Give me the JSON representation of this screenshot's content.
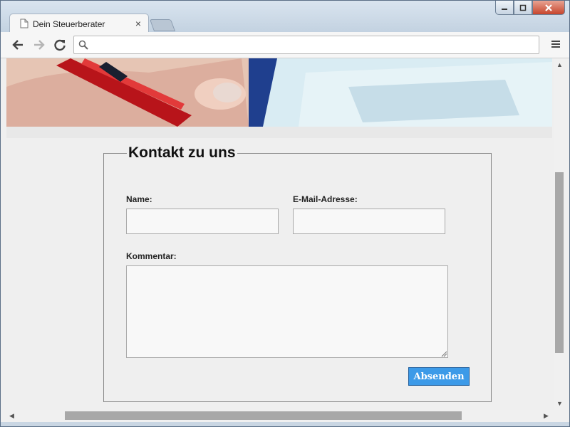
{
  "browser": {
    "tab_title": "Dein Steuerberater",
    "tab_close": "×",
    "url": ""
  },
  "form": {
    "legend": "Kontakt zu uns",
    "name_label": "Name:",
    "email_label": "E-Mail-Adresse:",
    "comment_label": "Kommentar:",
    "name_value": "",
    "email_value": "",
    "comment_value": "",
    "submit_label": "Absenden"
  },
  "colors": {
    "submit_bg": "#3c9ae8",
    "page_bg": "#efefef"
  },
  "icons": {
    "back": "back-arrow-icon",
    "forward": "forward-arrow-icon",
    "reload": "reload-icon",
    "search": "search-icon",
    "menu": "menu-icon"
  }
}
